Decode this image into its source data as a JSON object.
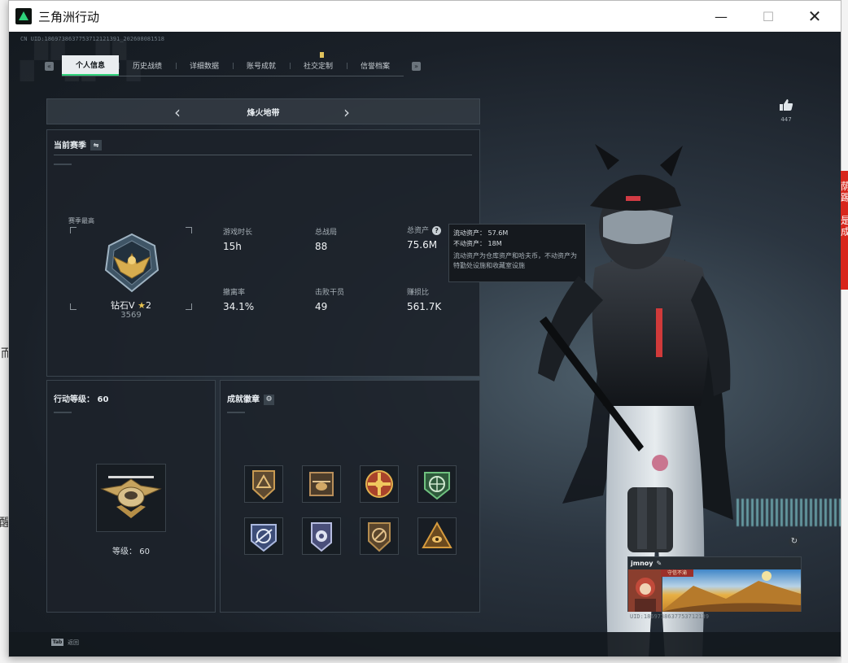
{
  "window": {
    "title": "三角洲行动",
    "controls": {
      "minimize": "—",
      "maximize": "☐",
      "close": "✕"
    }
  },
  "uid_line": "CN UID:1869738637753712121391_202608081518",
  "tabs": [
    {
      "label": "个人信息",
      "active": true
    },
    {
      "label": "历史战绩",
      "active": false
    },
    {
      "label": "详细数据",
      "active": false
    },
    {
      "label": "账号成就",
      "active": false
    },
    {
      "label": "社交定制",
      "active": false,
      "notification": true
    },
    {
      "label": "信誉档案",
      "active": false
    }
  ],
  "tab_nav": {
    "prev": "«",
    "next": "»"
  },
  "mode_selector": {
    "title": "烽火地带",
    "prev": "‹",
    "next": "›"
  },
  "season": {
    "title": "当前赛季",
    "swap_icon": "⇋",
    "best_label": "赛季最高",
    "rank_name": "钻石V",
    "rank_stars": "2",
    "rank_score": "3569",
    "stats": [
      {
        "key": "游戏时长",
        "value": "15h"
      },
      {
        "key": "总战局",
        "value": "88"
      },
      {
        "key": "总资产",
        "value": "75.6M",
        "help": "?"
      },
      {
        "key": "撤离率",
        "value": "34.1%"
      },
      {
        "key": "击败干员",
        "value": "49"
      },
      {
        "key": "赚损比",
        "value": "561.7K"
      }
    ]
  },
  "tooltip": {
    "liquid": "流动资产： 57.6M",
    "fixed": "不动资产： 18M",
    "note": "流动资产为仓库资产和哈夫币，不动资产为特勤处设施和收藏室设施"
  },
  "level_panel": {
    "title": "行动等级：",
    "title_value": "60",
    "level_text": "等级： 60"
  },
  "achievements": {
    "title": "成就徽章",
    "settings_icon": "⚙",
    "medals": [
      {
        "name": "triangle-medal",
        "color": "#c89a52"
      },
      {
        "name": "helicopter-medal",
        "color": "#b98e5a"
      },
      {
        "name": "cross-star-medal",
        "color": "#d65a3a"
      },
      {
        "name": "globe-medal",
        "color": "#4f9b62"
      },
      {
        "name": "satellite-medal",
        "color": "#7e96c9"
      },
      {
        "name": "shield-star-medal",
        "color": "#8a93c0"
      },
      {
        "name": "no-sign-medal",
        "color": "#b48c4f"
      },
      {
        "name": "eye-triangle-medal",
        "color": "#d59a3d"
      }
    ]
  },
  "like": {
    "icon": "thumbs-up-icon",
    "count": "447"
  },
  "card": {
    "name": "jmnoy",
    "edit_icon": "✎",
    "tag": "守信不渝",
    "uid": "UID:1869738637753712139"
  },
  "bottom": {
    "key": "Tab",
    "label": "返回"
  },
  "side_text": {
    "left": "而",
    "left2": "醒",
    "right1": "荫",
    "right2": "踢",
    "right3": "是",
    "right4": "成"
  }
}
